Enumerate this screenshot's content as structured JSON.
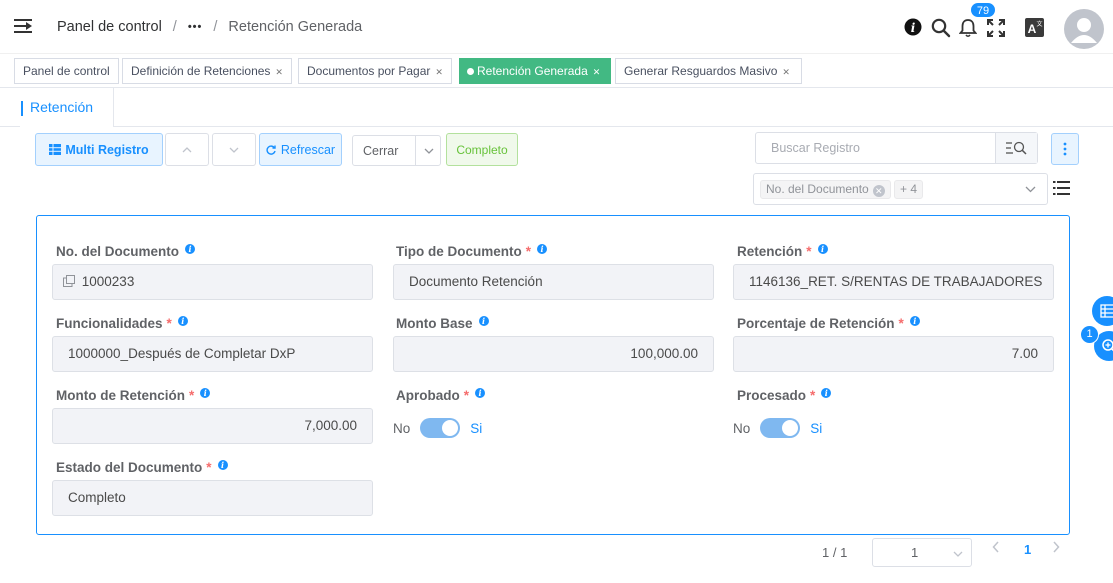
{
  "header": {
    "breadcrumb": [
      "Panel de control",
      "•••",
      "Retención Generada"
    ],
    "notification_count": "79",
    "icons": [
      "menu-toggle-icon",
      "info-icon",
      "search-icon",
      "bell-icon",
      "fullscreen-icon",
      "translate-icon",
      "avatar-icon"
    ]
  },
  "tags": [
    {
      "label": "Panel de control",
      "closable": false
    },
    {
      "label": "Definición de Retenciones",
      "closable": true
    },
    {
      "label": "Documentos por Pagar",
      "closable": true
    },
    {
      "label": "Retención Generada",
      "closable": true,
      "active": true
    },
    {
      "label": "Generar Resguardos Masivo",
      "closable": true
    }
  ],
  "tab": {
    "label": "Retención"
  },
  "toolbar": {
    "multi_registro": "Multi Registro",
    "refrescar": "Refrescar",
    "action_select": "Cerrar",
    "status_button": "Completo"
  },
  "search": {
    "placeholder": "Buscar Registro"
  },
  "column_selector": {
    "chip": "No. del Documento",
    "more": "+ 4"
  },
  "form": {
    "fields": {
      "no_documento": {
        "label": "No. del Documento",
        "value": "1000233"
      },
      "tipo_documento": {
        "label": "Tipo de Documento",
        "value": "Documento Retención"
      },
      "retencion": {
        "label": "Retención",
        "value": "1146136_RET. S/RENTAS DE TRABAJADORES"
      },
      "funcionalidades": {
        "label": "Funcionalidades",
        "value": "1000000_Después de Completar DxP"
      },
      "monto_base": {
        "label": "Monto Base",
        "value": "100,000.00"
      },
      "porcentaje": {
        "label": "Porcentaje de Retención",
        "value": "7.00"
      },
      "monto_retencion": {
        "label": "Monto de Retención",
        "value": "7,000.00"
      },
      "aprobado": {
        "label": "Aprobado",
        "off_label": "No",
        "on_label": "Si",
        "value": true
      },
      "procesado": {
        "label": "Procesado",
        "off_label": "No",
        "on_label": "Si",
        "value": true
      },
      "estado": {
        "label": "Estado del Documento",
        "value": "Completo"
      }
    },
    "required_mark": "*",
    "info_mark": "i"
  },
  "pagination": {
    "record_count": "1 / 1",
    "page_select": "1",
    "current_page": "1"
  },
  "floating": {
    "badge": "1"
  },
  "colors": {
    "accent": "#1890ff",
    "active_tag": "#42b983",
    "required": "#f56c6c"
  }
}
